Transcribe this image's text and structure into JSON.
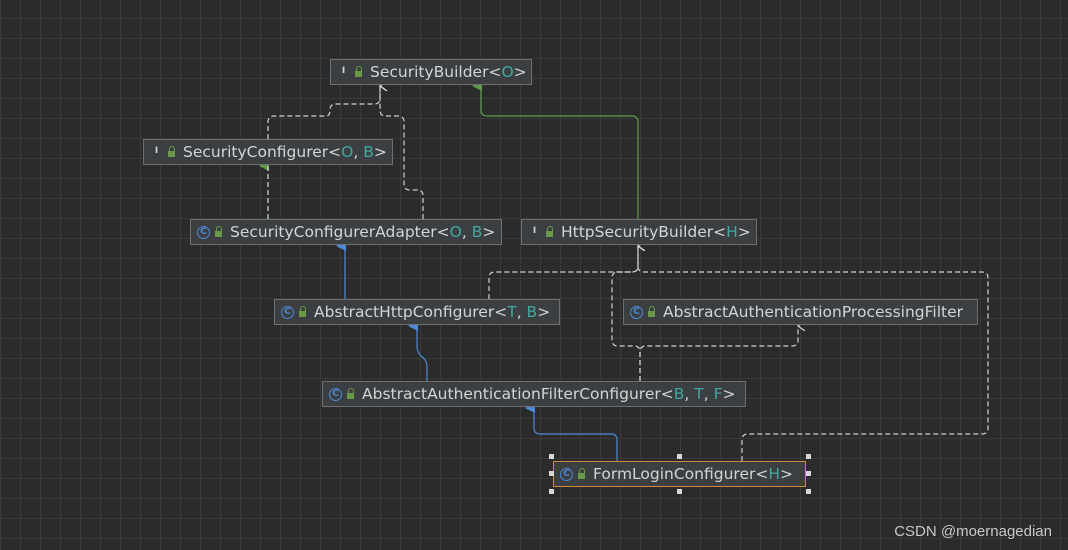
{
  "nodes": [
    {
      "id": "security-builder",
      "kind": "interface",
      "kind_glyph": "I",
      "name": "SecurityBuilder",
      "params": [
        "O"
      ]
    },
    {
      "id": "security-configurer",
      "kind": "interface",
      "kind_glyph": "I",
      "name": "SecurityConfigurer",
      "params": [
        "O",
        "B"
      ]
    },
    {
      "id": "security-configurer-adapter",
      "kind": "class",
      "kind_glyph": "C",
      "name": "SecurityConfigurerAdapter",
      "params": [
        "O",
        "B"
      ]
    },
    {
      "id": "http-security-builder",
      "kind": "interface",
      "kind_glyph": "I",
      "name": "HttpSecurityBuilder",
      "params": [
        "H"
      ]
    },
    {
      "id": "abstract-http-configurer",
      "kind": "class",
      "kind_glyph": "C",
      "name": "AbstractHttpConfigurer",
      "params": [
        "T",
        "B"
      ]
    },
    {
      "id": "abstract-authentication-processing-filter",
      "kind": "class",
      "kind_glyph": "C",
      "name": "AbstractAuthenticationProcessingFilter",
      "params": []
    },
    {
      "id": "abstract-authentication-filter-configurer",
      "kind": "class",
      "kind_glyph": "C",
      "name": "AbstractAuthenticationFilterConfigurer",
      "params": [
        "B",
        "T",
        "F"
      ]
    },
    {
      "id": "form-login-configurer",
      "kind": "class",
      "kind_glyph": "C",
      "name": "FormLoginConfigurer",
      "params": [
        "H"
      ],
      "selected": true
    }
  ],
  "edges": [
    {
      "from": "security-configurer-adapter",
      "to": "security-builder",
      "type": "dependency"
    },
    {
      "from": "security-configurer-adapter",
      "to": "security-configurer",
      "type": "implements"
    },
    {
      "from": "http-security-builder",
      "to": "security-builder",
      "type": "extends-interface"
    },
    {
      "from": "abstract-http-configurer",
      "to": "security-configurer-adapter",
      "type": "extends"
    },
    {
      "from": "abstract-http-configurer",
      "to": "http-security-builder",
      "type": "dependency"
    },
    {
      "from": "abstract-authentication-filter-configurer",
      "to": "abstract-http-configurer",
      "type": "extends"
    },
    {
      "from": "abstract-authentication-filter-configurer",
      "to": "http-security-builder",
      "type": "dependency"
    },
    {
      "from": "abstract-authentication-filter-configurer",
      "to": "abstract-authentication-processing-filter",
      "type": "dependency"
    },
    {
      "from": "form-login-configurer",
      "to": "abstract-authentication-filter-configurer",
      "type": "extends"
    },
    {
      "from": "form-login-configurer",
      "to": "http-security-builder",
      "type": "dependency"
    }
  ],
  "colors": {
    "background": "#2b2b2b",
    "node_fill": "#3c3f41",
    "node_border": "#6f6f6f",
    "selected_border": "#d08a3c",
    "type_param": "#3fa8a0",
    "extends_edge": "#4d8bd8",
    "implements_edge": "#5f9c4a",
    "dependency_edge": "#c8c8c8"
  },
  "watermark": "CSDN @moernagedian"
}
